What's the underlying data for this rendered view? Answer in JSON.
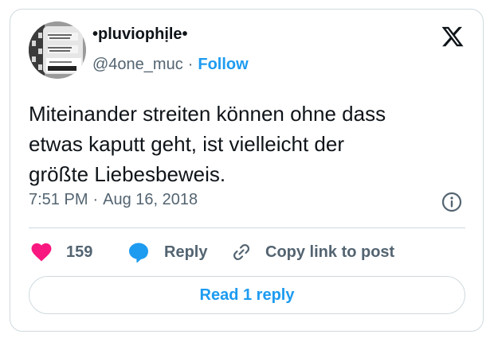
{
  "author": {
    "display_name": "•pluviophịle•",
    "handle": "@4one_muc",
    "separator": "·",
    "follow_label": "Follow",
    "avatar_lettering": [
      "WHAT",
      "HAPPENED",
      "TO YOU?",
      "WHAT",
      "HAPPENED",
      "TO ME?",
      "CAUSING",
      "PAIN"
    ]
  },
  "tweet": {
    "text_lines": [
      "Miteinander streiten können ohne dass",
      "etwas kaputt geht, ist vielleicht der",
      "größte Liebesbeweis."
    ],
    "time": "7:51 PM",
    "separator": "·",
    "date": "Aug 16, 2018"
  },
  "actions": {
    "like_count": "159",
    "reply_label": "Reply",
    "copy_label": "Copy link to post",
    "read_replies_label": "Read 1 reply"
  },
  "icons": {
    "logo": "x-logo-icon",
    "info": "info-icon",
    "like": "heart-icon",
    "reply": "reply-bubble-icon",
    "copy": "link-icon"
  },
  "colors": {
    "accent": "#1d9bf0",
    "heart": "#f91880",
    "text": "#0f1419",
    "muted": "#536471",
    "border": "#cfd9de"
  }
}
